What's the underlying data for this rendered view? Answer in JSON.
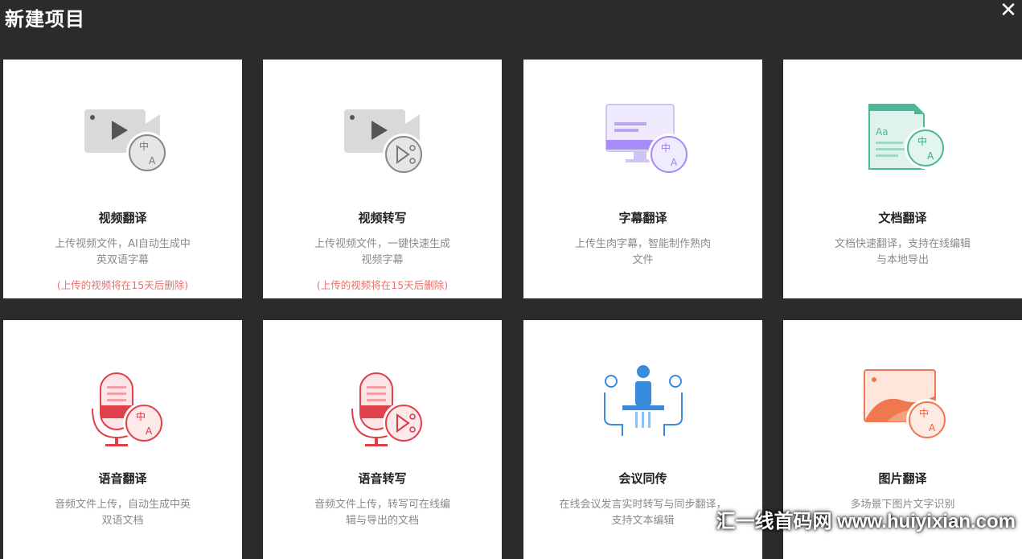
{
  "window": {
    "title": "新建项目",
    "close_glyph": "✕"
  },
  "cards": [
    {
      "name": "视频翻译",
      "desc": "上传视频文件，AI自动生成中英双语字幕",
      "note": "(上传的视频将在15天后删除)"
    },
    {
      "name": "视频转写",
      "desc": "上传视频文件，一键快速生成视频字幕",
      "note": "(上传的视频将在15天后删除)"
    },
    {
      "name": "字幕翻译",
      "desc": "上传生肉字幕，智能制作熟肉文件",
      "note": ""
    },
    {
      "name": "文档翻译",
      "desc": "文档快速翻译，支持在线编辑与本地导出",
      "note": ""
    },
    {
      "name": "语音翻译",
      "desc": "音频文件上传，自动生成中英双语文档",
      "note": ""
    },
    {
      "name": "语音转写",
      "desc": "音频文件上传，转写可在线编辑与导出的文档",
      "note": ""
    },
    {
      "name": "会议同传",
      "desc": "在线会议发言实时转写与同步翻译，支持文本编辑",
      "note": ""
    },
    {
      "name": "图片翻译",
      "desc": "多场景下图片文字识别",
      "note": ""
    }
  ],
  "watermark": "汇一线首码网 www.huiyixian.com",
  "colors": {
    "bg": "#2b2b2b",
    "card": "#ffffff",
    "gray_icon": "#d9d9d9",
    "purple": "#a78bfa",
    "green": "#4cb89a",
    "red": "#e0404a",
    "blue": "#3b8bdc",
    "orange": "#f07850",
    "note": "#e8706a"
  },
  "icons": [
    "video-translate-icon",
    "video-transcribe-icon",
    "subtitle-translate-icon",
    "document-translate-icon",
    "voice-translate-icon",
    "voice-transcribe-icon",
    "meeting-interpret-icon",
    "image-translate-icon"
  ]
}
